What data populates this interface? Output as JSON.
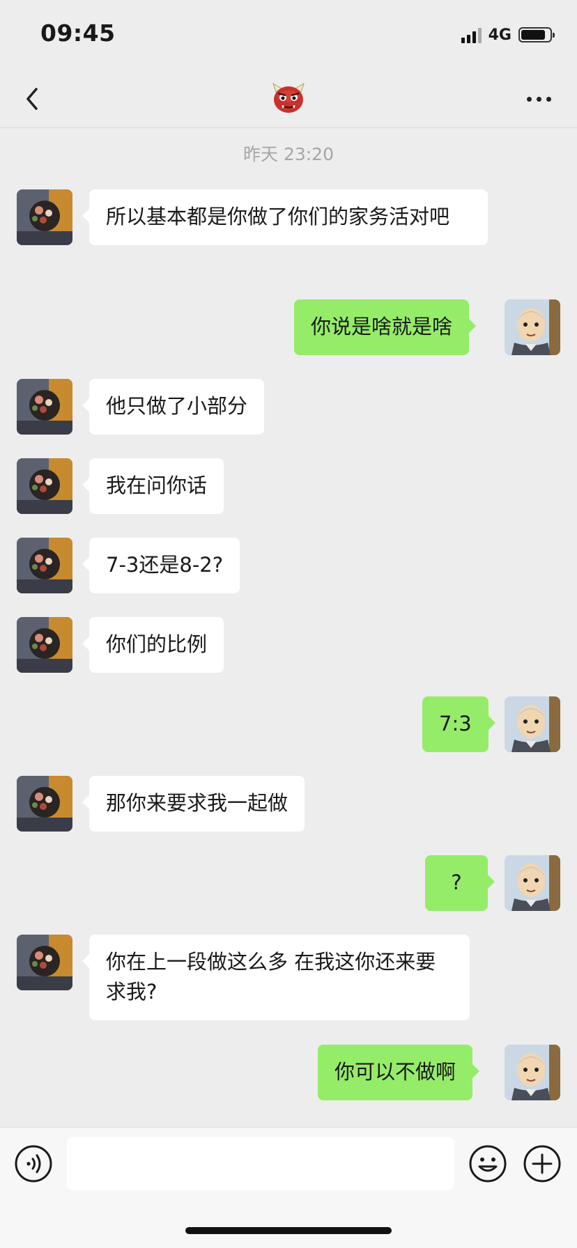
{
  "status_bar": {
    "time": "09:45",
    "network": "4G"
  },
  "header": {
    "title_icon": "ogre-face-icon",
    "back_icon": "chevron-left-icon",
    "more_icon": "ellipsis-icon"
  },
  "timestamp": "昨天 23:20",
  "messages": [
    {
      "side": "in",
      "text": "所以基本都是你做了你们的家务活对吧"
    },
    {
      "side": "out",
      "text": "你说是啥就是啥"
    },
    {
      "side": "in",
      "text": "他只做了小部分"
    },
    {
      "side": "in",
      "text": "我在问你话"
    },
    {
      "side": "in",
      "text": "7-3还是8-2?"
    },
    {
      "side": "in",
      "text": "你们的比例"
    },
    {
      "side": "out",
      "text": "7:3"
    },
    {
      "side": "in",
      "text": "那你来要求我一起做"
    },
    {
      "side": "out",
      "text": "?"
    },
    {
      "side": "in",
      "text": "你在上一段做这么多 在我这你还来要求我?"
    },
    {
      "side": "out",
      "text": "你可以不做啊"
    }
  ],
  "input_bar": {
    "value": "",
    "placeholder": ""
  },
  "colors": {
    "background": "#ededed",
    "bubble_in": "#ffffff",
    "bubble_out": "#95ec69"
  }
}
